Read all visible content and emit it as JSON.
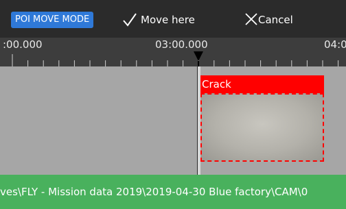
{
  "toolbar": {
    "mode_badge": "POI MOVE MODE",
    "move_here_label": "Move here",
    "cancel_label": "Cancel"
  },
  "timeline": {
    "ruler_labels": [
      ":00.000",
      "03:00.000",
      "04:0"
    ]
  },
  "poi": {
    "label": "Crack",
    "color": "#ff0000"
  },
  "status": {
    "path": "ves\\FLY - Mission data 2019\\2019-04-30 Blue factory\\CAM\\0"
  },
  "colors": {
    "accent": "#2f79d8",
    "status_bar": "#49b15d"
  }
}
